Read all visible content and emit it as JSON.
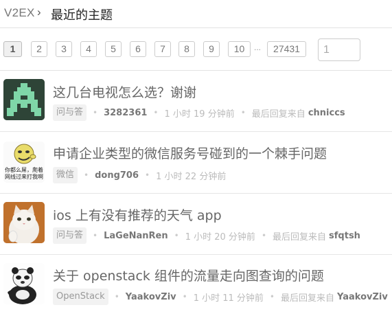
{
  "breadcrumb": {
    "root": "V2EX",
    "separator": "›",
    "title": "最近的主题"
  },
  "pagination": {
    "pages": [
      "1",
      "2",
      "3",
      "4",
      "5",
      "6",
      "7",
      "8",
      "9",
      "10"
    ],
    "current": "1",
    "ellipsis": "...",
    "last": "27431",
    "jump_value": "1"
  },
  "topics": [
    {
      "title": "这几台电视怎么选？谢谢",
      "node": "问与答",
      "author": "3282361",
      "time": "1 小时 19 分钟前",
      "last_reply_prefix": "最后回复来自",
      "last_reply_user": "chniccs",
      "avatar": "pixel-invader-avatar"
    },
    {
      "title": "申请企业类型的微信服务号碰到的一个棘手问题",
      "node": "微信",
      "author": "dong706",
      "time": "1 小时 22 分钟前",
      "last_reply_prefix": "",
      "last_reply_user": "",
      "avatar": "meme-face-avatar",
      "avatar_text": "你都么屌，爬着网线过来打我啊"
    },
    {
      "title": "ios 上有没有推荐的天气 app",
      "node": "问与答",
      "author": "LaGeNanRen",
      "time": "1 小时 20 分钟前",
      "last_reply_prefix": "最后回复来自",
      "last_reply_user": "sfqtsh",
      "avatar": "cat-avatar"
    },
    {
      "title": "关于 openstack 组件的流量走向图查询的问题",
      "node": "OpenStack",
      "author": "YaakovZiv",
      "time": "1 小时 11 分钟前",
      "last_reply_prefix": "最后回复来自",
      "last_reply_user": "YaakovZiv",
      "avatar": "panda-avatar"
    }
  ]
}
